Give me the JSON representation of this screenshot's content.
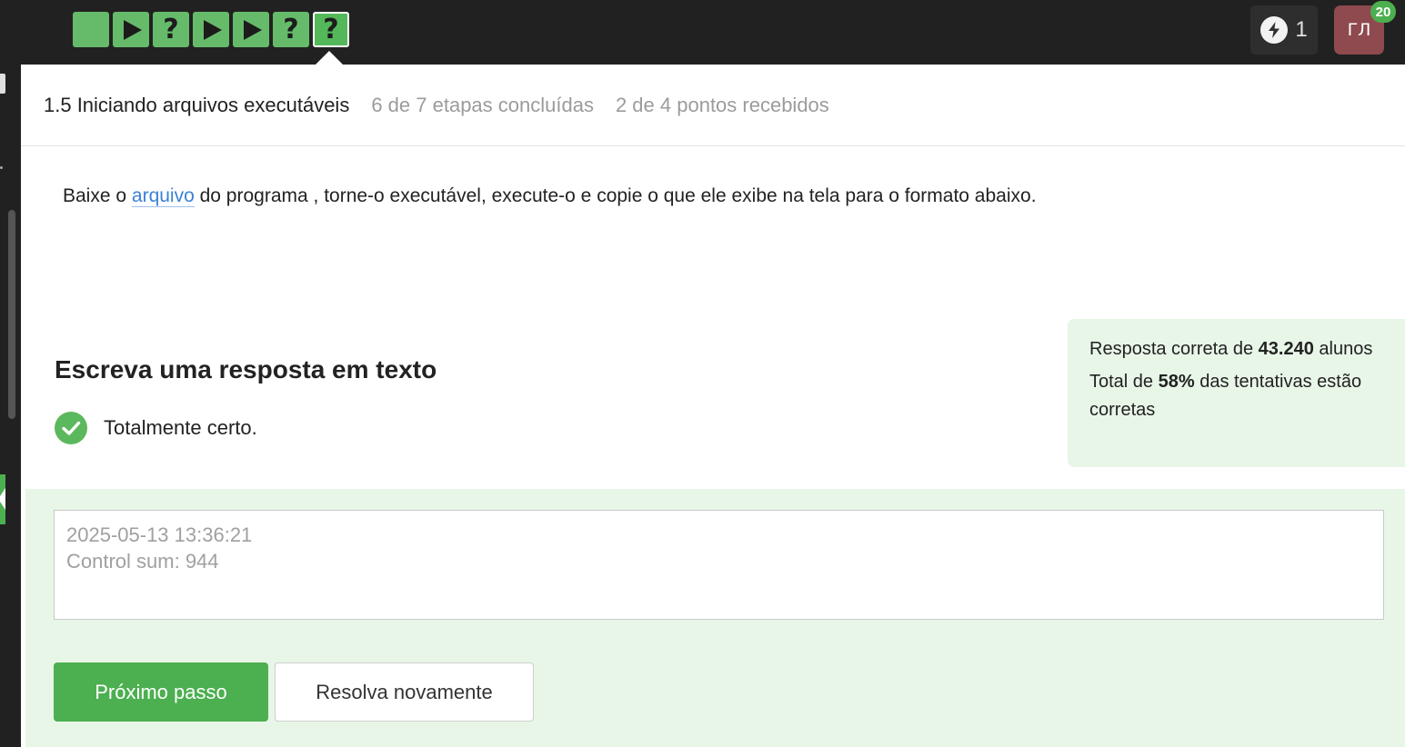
{
  "steps": [
    {
      "kind": "text",
      "status": "completed"
    },
    {
      "kind": "play",
      "status": "completed"
    },
    {
      "kind": "question",
      "symbol": "?",
      "status": "completed"
    },
    {
      "kind": "play",
      "status": "completed"
    },
    {
      "kind": "play",
      "status": "completed"
    },
    {
      "kind": "question",
      "symbol": "?",
      "status": "completed"
    },
    {
      "kind": "question",
      "symbol": "?",
      "status": "current"
    }
  ],
  "topbar": {
    "energy_count": "1",
    "avatar_initials": "ГЛ",
    "avatar_badge": "20"
  },
  "header": {
    "lesson_title": "1.5 Iniciando arquivos executáveis",
    "steps_done": "6 de 7 etapas concluídas",
    "points": "2 de 4 pontos recebidos"
  },
  "task": {
    "before": "Baixe o ",
    "link": "arquivo",
    "after": " do programa  , torne-o executável, execute-o e copie o que ele exibe na tela para o formato abaixo."
  },
  "answer": {
    "title": "Escreva uma resposta em texto",
    "result": "Totalmente certo.",
    "value": "2025-05-13 13:36:21\nControl sum: 944"
  },
  "stats": {
    "line1_prefix": "Resposta correta de ",
    "line1_count": "43.240",
    "line1_suffix": " alunos",
    "line2_prefix": "Total de ",
    "line2_percent": "58%",
    "line2_suffix": " das tentativas estão corretas"
  },
  "buttons": {
    "next": "Próximo passo",
    "retry": "Resolva novamente"
  },
  "colors": {
    "accent_green": "#4caf50",
    "step_green": "#66bb6a",
    "link_blue": "#3b82d6",
    "avatar_bg": "#8e4a4e"
  }
}
